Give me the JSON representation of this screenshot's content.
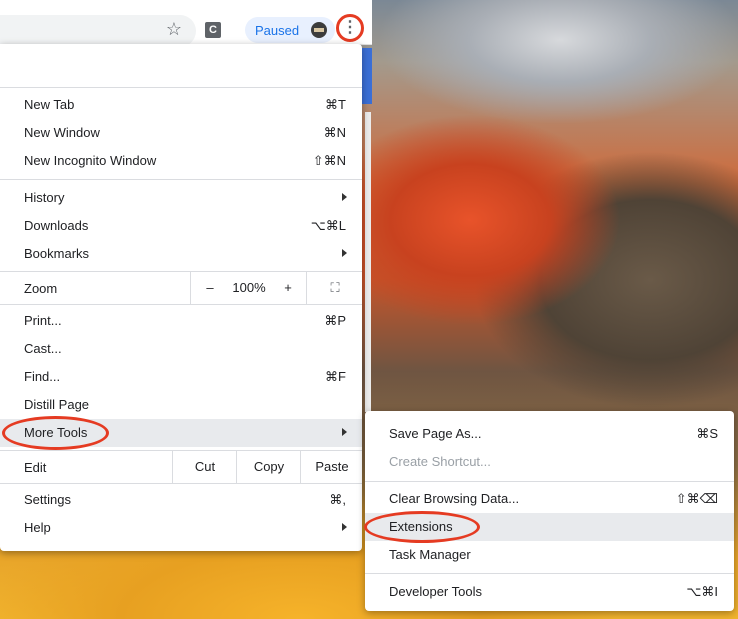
{
  "toolbar": {
    "profile_label": "Paused",
    "extension_letter": "C",
    "star_glyph": "☆",
    "menu_glyph": "⋮"
  },
  "main_menu": {
    "group1": [
      {
        "label": "New Tab",
        "shortcut": "⌘T"
      },
      {
        "label": "New Window",
        "shortcut": "⌘N"
      },
      {
        "label": "New Incognito Window",
        "shortcut": "⇧⌘N"
      }
    ],
    "group2": [
      {
        "label": "History",
        "shortcut": ""
      },
      {
        "label": "Downloads",
        "shortcut": "⌥⌘L"
      },
      {
        "label": "Bookmarks",
        "shortcut": ""
      }
    ],
    "zoom": {
      "label": "Zoom",
      "minus": "–",
      "value": "100%",
      "plus": "+",
      "fullscreen": "⛶"
    },
    "group3": [
      {
        "label": "Print...",
        "shortcut": "⌘P"
      },
      {
        "label": "Cast...",
        "shortcut": ""
      },
      {
        "label": "Find...",
        "shortcut": "⌘F"
      },
      {
        "label": "Distill Page",
        "shortcut": ""
      },
      {
        "label": "More Tools",
        "shortcut": ""
      }
    ],
    "edit": {
      "label": "Edit",
      "cut": "Cut",
      "copy": "Copy",
      "paste": "Paste"
    },
    "group4": [
      {
        "label": "Settings",
        "shortcut": "⌘,"
      },
      {
        "label": "Help",
        "shortcut": ""
      }
    ]
  },
  "sub_menu": {
    "items": [
      {
        "label": "Save Page As...",
        "shortcut": "⌘S"
      },
      {
        "label": "Create Shortcut...",
        "shortcut": ""
      },
      {
        "label": "Clear Browsing Data...",
        "shortcut": "⇧⌘⌫"
      },
      {
        "label": "Extensions",
        "shortcut": ""
      },
      {
        "label": "Task Manager",
        "shortcut": ""
      },
      {
        "label": "Developer Tools",
        "shortcut": "⌥⌘I"
      }
    ]
  },
  "colors": {
    "highlight": "#e53b22",
    "hover": "#e8eaed",
    "profile_accent": "#1a73e8"
  }
}
